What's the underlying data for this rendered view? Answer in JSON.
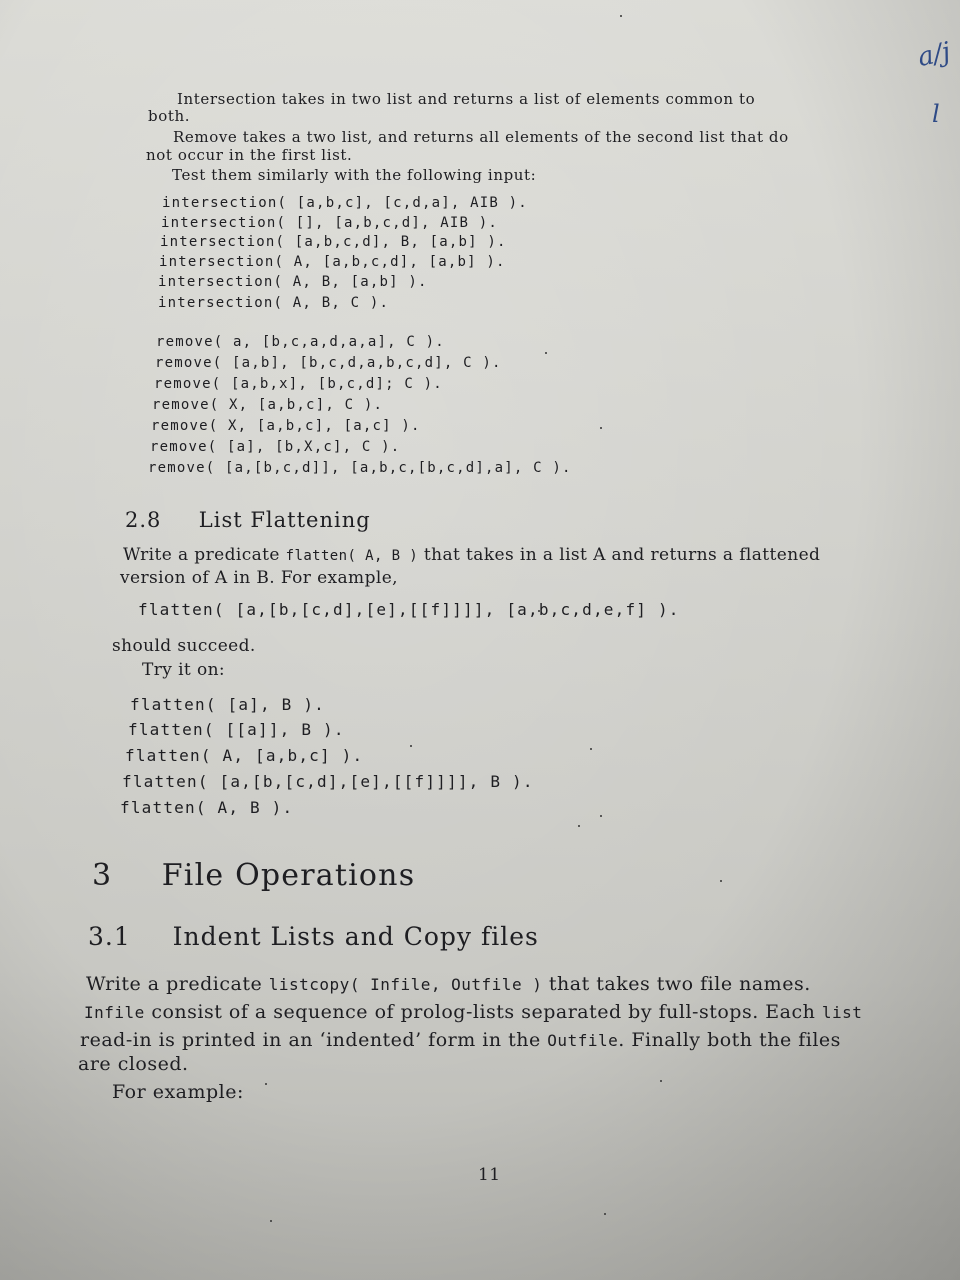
{
  "top_paragraphs": [
    {
      "line1": "Intersection takes in two list and returns a list of elements common to",
      "line2": "both."
    },
    {
      "line1": "Remove takes a two list, and returns all elements of the second list that do",
      "line2": "not occur in the first list."
    },
    {
      "line1": "Test them similarly with the following input:"
    }
  ],
  "intersection_lines": [
    "intersection( [a,b,c], [c,d,a], AIB ).",
    "intersection( [], [a,b,c,d], AIB ).",
    "intersection( [a,b,c,d], B, [a,b] ).",
    "intersection( A, [a,b,c,d], [a,b] ).",
    "intersection( A, B, [a,b] ).",
    "intersection( A, B, C )."
  ],
  "remove_lines": [
    "remove( a, [b,c,a,d,a,a], C ).",
    "remove( [a,b], [b,c,d,a,b,c,d], C ).",
    "remove( [a,b,x], [b,c,d]; C ).",
    "remove( X, [a,b,c], C ).",
    "remove( X, [a,b,c], [a,c] ).",
    "remove( [a], [b,X,c], C ).",
    "remove( [a,[b,c,d]], [a,b,c,[b,c,d],a], C )."
  ],
  "section_2_8": {
    "number": "2.8",
    "title": "List Flattening",
    "para_line1_pre": "Write a predicate ",
    "para_line1_code": "flatten( A, B )",
    "para_line1_post": " that takes in a list A and returns a flattened",
    "para_line2": "version of A in B. For example,",
    "example": "flatten( [a,[b,[c,d],[e],[[f]]]], [a,b,c,d,e,f] ).",
    "should_succeed": "should succeed.",
    "try_it_on": "Try it on:",
    "try_lines": [
      "flatten( [a], B ).",
      "flatten( [[a]], B ).",
      "flatten( A, [a,b,c] ).",
      "flatten( [a,[b,[c,d],[e],[[f]]]], B ).",
      "flatten( A, B )."
    ]
  },
  "section_3": {
    "number": "3",
    "title": "File Operations"
  },
  "section_3_1": {
    "number": "3.1",
    "title": "Indent Lists and Copy files",
    "line1_pre": "Write a predicate ",
    "line1_code": "listcopy( Infile, Outfile )",
    "line1_post": " that takes two file names.",
    "line2_code": "Infile",
    "line2_post": " consist of a sequence of prolog-lists separated by full-stops. Each ",
    "line2_code2": "list",
    "line3_pre": "read-in is printed in an ‘indented’ form in the ",
    "line3_code": "Outfile",
    "line3_post": ". Finally both the files",
    "line4": "are closed.",
    "for_example": "For example:"
  },
  "page_number": "11",
  "margin_notes": [
    "a/j",
    "l"
  ],
  "colors": {
    "paper": "#d6d6d1",
    "ink": "#1e1e22",
    "margin_ink": "#2e4a86"
  }
}
